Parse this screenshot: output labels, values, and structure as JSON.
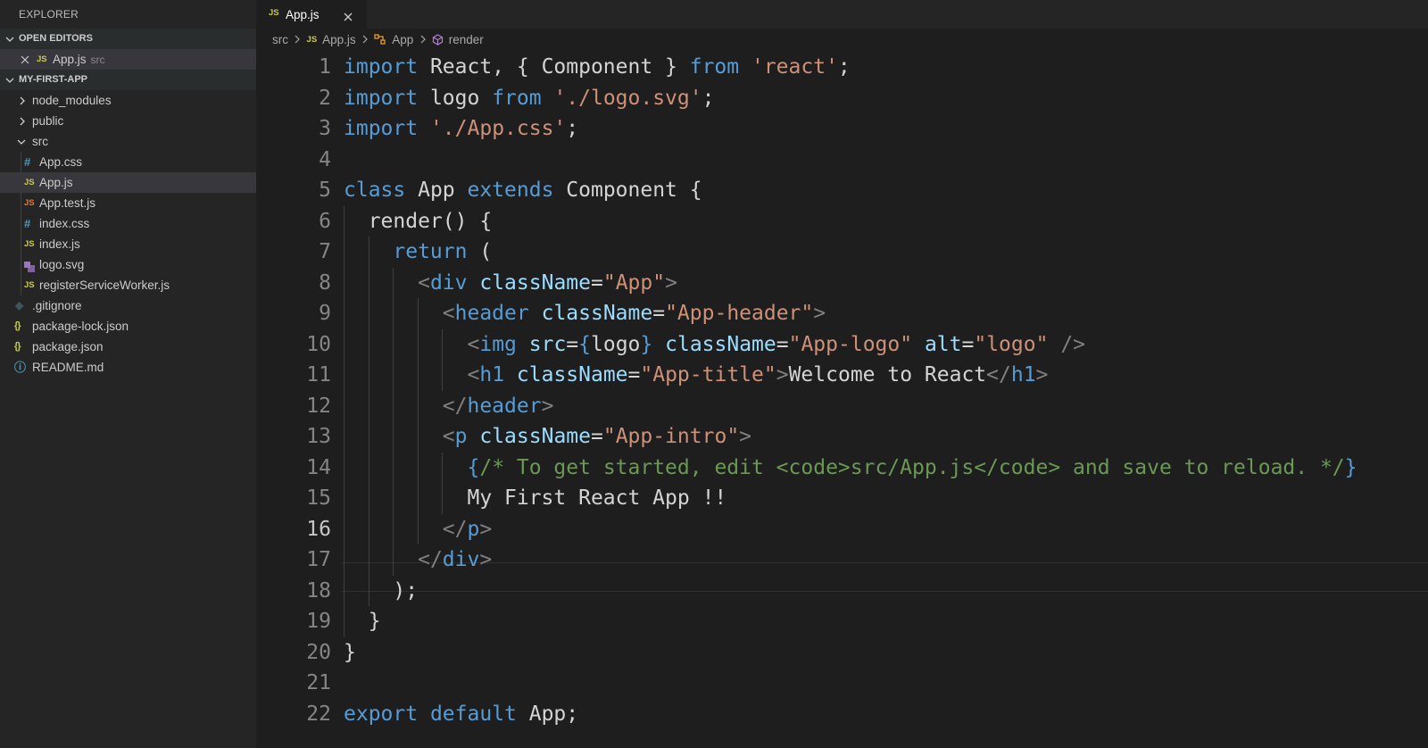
{
  "sidebar": {
    "title": "EXPLORER",
    "open_editors": {
      "label": "OPEN EDITORS",
      "items": [
        {
          "name": "App.js",
          "folder": "src",
          "icon": "js-file-icon"
        }
      ]
    },
    "project": {
      "label": "MY-FIRST-APP",
      "items": [
        {
          "name": "node_modules",
          "type": "folder",
          "expanded": false
        },
        {
          "name": "public",
          "type": "folder",
          "expanded": false
        },
        {
          "name": "src",
          "type": "folder",
          "expanded": true
        },
        {
          "name": "App.css",
          "type": "css",
          "icon": "css-file-icon"
        },
        {
          "name": "App.js",
          "type": "js",
          "icon": "js-file-icon",
          "selected": true
        },
        {
          "name": "App.test.js",
          "type": "test",
          "icon": "test-file-icon"
        },
        {
          "name": "index.css",
          "type": "css",
          "icon": "css-file-icon"
        },
        {
          "name": "index.js",
          "type": "js",
          "icon": "js-file-icon"
        },
        {
          "name": "logo.svg",
          "type": "svg",
          "icon": "svg-file-icon"
        },
        {
          "name": "registerServiceWorker.js",
          "type": "js",
          "icon": "js-file-icon"
        },
        {
          "name": ".gitignore",
          "type": "git",
          "icon": "git-file-icon"
        },
        {
          "name": "package-lock.json",
          "type": "json",
          "icon": "json-file-icon"
        },
        {
          "name": "package.json",
          "type": "json",
          "icon": "json-file-icon"
        },
        {
          "name": "README.md",
          "type": "info",
          "icon": "info-file-icon"
        }
      ]
    }
  },
  "tabs": [
    {
      "label": "App.js",
      "icon": "js-file-icon",
      "close_icon": "close-icon"
    }
  ],
  "breadcrumb": {
    "items": [
      {
        "label": "src"
      },
      {
        "label": "App.js",
        "icon": "js-file-icon"
      },
      {
        "label": "App",
        "icon": "class-symbol-icon"
      },
      {
        "label": "render",
        "icon": "method-symbol-icon"
      }
    ]
  },
  "editor": {
    "active_line": 16,
    "lines": [
      [
        [
          "kw",
          "import"
        ],
        [
          "plain",
          " React, { Component } "
        ],
        [
          "kw",
          "from"
        ],
        [
          "plain",
          " "
        ],
        [
          "str",
          "'react'"
        ],
        [
          "plain",
          ";"
        ]
      ],
      [
        [
          "kw",
          "import"
        ],
        [
          "plain",
          " logo "
        ],
        [
          "kw",
          "from"
        ],
        [
          "plain",
          " "
        ],
        [
          "str",
          "'./logo.svg'"
        ],
        [
          "plain",
          ";"
        ]
      ],
      [
        [
          "kw",
          "import"
        ],
        [
          "plain",
          " "
        ],
        [
          "str",
          "'./App.css'"
        ],
        [
          "plain",
          ";"
        ]
      ],
      [],
      [
        [
          "kw",
          "class"
        ],
        [
          "plain",
          " App "
        ],
        [
          "kw",
          "extends"
        ],
        [
          "plain",
          " Component {"
        ]
      ],
      [
        [
          "plain",
          "  render() {"
        ]
      ],
      [
        [
          "plain",
          "    "
        ],
        [
          "kw",
          "return"
        ],
        [
          "plain",
          " ("
        ]
      ],
      [
        [
          "plain",
          "      "
        ],
        [
          "punc",
          "<"
        ],
        [
          "tag",
          "div"
        ],
        [
          "plain",
          " "
        ],
        [
          "attr",
          "className"
        ],
        [
          "plain",
          "="
        ],
        [
          "str",
          "\"App\""
        ],
        [
          "punc",
          ">"
        ]
      ],
      [
        [
          "plain",
          "        "
        ],
        [
          "punc",
          "<"
        ],
        [
          "tag",
          "header"
        ],
        [
          "plain",
          " "
        ],
        [
          "attr",
          "className"
        ],
        [
          "plain",
          "="
        ],
        [
          "str",
          "\"App-header\""
        ],
        [
          "punc",
          ">"
        ]
      ],
      [
        [
          "plain",
          "          "
        ],
        [
          "punc",
          "<"
        ],
        [
          "tag",
          "img"
        ],
        [
          "plain",
          " "
        ],
        [
          "attr",
          "src"
        ],
        [
          "plain",
          "="
        ],
        [
          "kw",
          "{"
        ],
        [
          "plain",
          "logo"
        ],
        [
          "kw",
          "}"
        ],
        [
          "plain",
          " "
        ],
        [
          "attr",
          "className"
        ],
        [
          "plain",
          "="
        ],
        [
          "str",
          "\"App-logo\""
        ],
        [
          "plain",
          " "
        ],
        [
          "attr",
          "alt"
        ],
        [
          "plain",
          "="
        ],
        [
          "str",
          "\"logo\""
        ],
        [
          "plain",
          " "
        ],
        [
          "punc",
          "/>"
        ]
      ],
      [
        [
          "plain",
          "          "
        ],
        [
          "punc",
          "<"
        ],
        [
          "tag",
          "h1"
        ],
        [
          "plain",
          " "
        ],
        [
          "attr",
          "className"
        ],
        [
          "plain",
          "="
        ],
        [
          "str",
          "\"App-title\""
        ],
        [
          "punc",
          ">"
        ],
        [
          "plain",
          "Welcome to React"
        ],
        [
          "punc",
          "</"
        ],
        [
          "tag",
          "h1"
        ],
        [
          "punc",
          ">"
        ]
      ],
      [
        [
          "plain",
          "        "
        ],
        [
          "punc",
          "</"
        ],
        [
          "tag",
          "header"
        ],
        [
          "punc",
          ">"
        ]
      ],
      [
        [
          "plain",
          "        "
        ],
        [
          "punc",
          "<"
        ],
        [
          "tag",
          "p"
        ],
        [
          "plain",
          " "
        ],
        [
          "attr",
          "className"
        ],
        [
          "plain",
          "="
        ],
        [
          "str",
          "\"App-intro\""
        ],
        [
          "punc",
          ">"
        ]
      ],
      [
        [
          "plain",
          "          "
        ],
        [
          "kw",
          "{"
        ],
        [
          "cmt",
          "/* To get started, edit <code>src/App.js</code> and save to reload. */"
        ],
        [
          "kw",
          "}"
        ]
      ],
      [
        [
          "plain",
          "          My First React App !!"
        ]
      ],
      [
        [
          "plain",
          "        "
        ],
        [
          "punc",
          "</"
        ],
        [
          "tag",
          "p"
        ],
        [
          "punc",
          ">"
        ]
      ],
      [
        [
          "plain",
          "      "
        ],
        [
          "punc",
          "</"
        ],
        [
          "tag",
          "div"
        ],
        [
          "punc",
          ">"
        ]
      ],
      [
        [
          "plain",
          "    );"
        ]
      ],
      [
        [
          "plain",
          "  }"
        ]
      ],
      [
        [
          "plain",
          "}"
        ]
      ],
      [],
      [
        [
          "kw",
          "export"
        ],
        [
          "plain",
          " "
        ],
        [
          "kw",
          "default"
        ],
        [
          "plain",
          " App;"
        ]
      ]
    ]
  }
}
